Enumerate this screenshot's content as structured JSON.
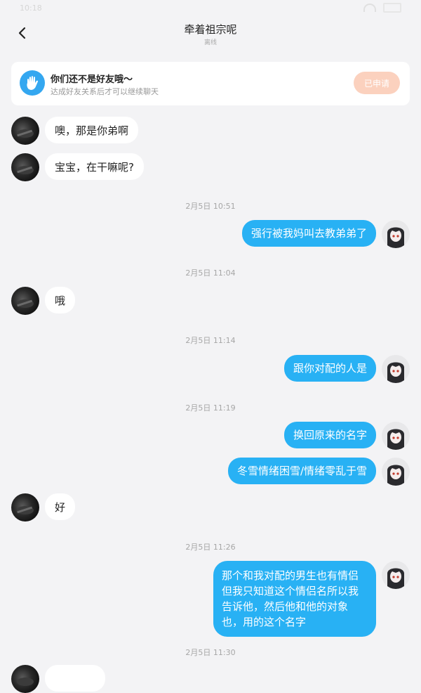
{
  "status": {
    "time": "10:18"
  },
  "header": {
    "title": "牵着祖宗呢",
    "subtitle": "离线"
  },
  "friend_banner": {
    "title": "你们还不是好友哦～",
    "subtitle": "达成好友关系后才可以继续聊天",
    "button": "已申请"
  },
  "icons": {
    "back": "chevron-left-icon",
    "hand": "hand-wave-icon",
    "wifi": "wifi-icon",
    "battery": "battery-icon"
  },
  "colors": {
    "outgoing_bubble": "#28b1f4",
    "incoming_bubble": "#ffffff",
    "applied_button": "#fbd1be",
    "hand_icon_bg": "#34a7f0",
    "background": "#f3f3f5"
  },
  "messages": [
    {
      "side": "left",
      "text": "噢，那是你弟啊"
    },
    {
      "side": "left",
      "text": "宝宝，在干嘛呢?"
    },
    {
      "type": "timestamp",
      "text": "2月5日 10:51"
    },
    {
      "side": "right",
      "text": "强行被我妈叫去教弟弟了"
    },
    {
      "type": "timestamp",
      "text": "2月5日 11:04"
    },
    {
      "side": "left",
      "text": "哦"
    },
    {
      "type": "timestamp",
      "text": "2月5日 11:14"
    },
    {
      "side": "right",
      "text": "跟你对配的人是"
    },
    {
      "type": "timestamp",
      "text": "2月5日 11:19"
    },
    {
      "side": "right",
      "text": "换回原来的名字"
    },
    {
      "side": "right",
      "text": "冬雪情绪困雪/情绪零乱于雪"
    },
    {
      "side": "left",
      "text": "好"
    },
    {
      "type": "timestamp",
      "text": "2月5日 11:26"
    },
    {
      "side": "right",
      "text": "那个和我对配的男生也有情侣但我只知道这个情侣名所以我告诉他，然后他和他的对象也，用的这个名字"
    },
    {
      "type": "timestamp",
      "text": "2月5日 11:30"
    }
  ]
}
